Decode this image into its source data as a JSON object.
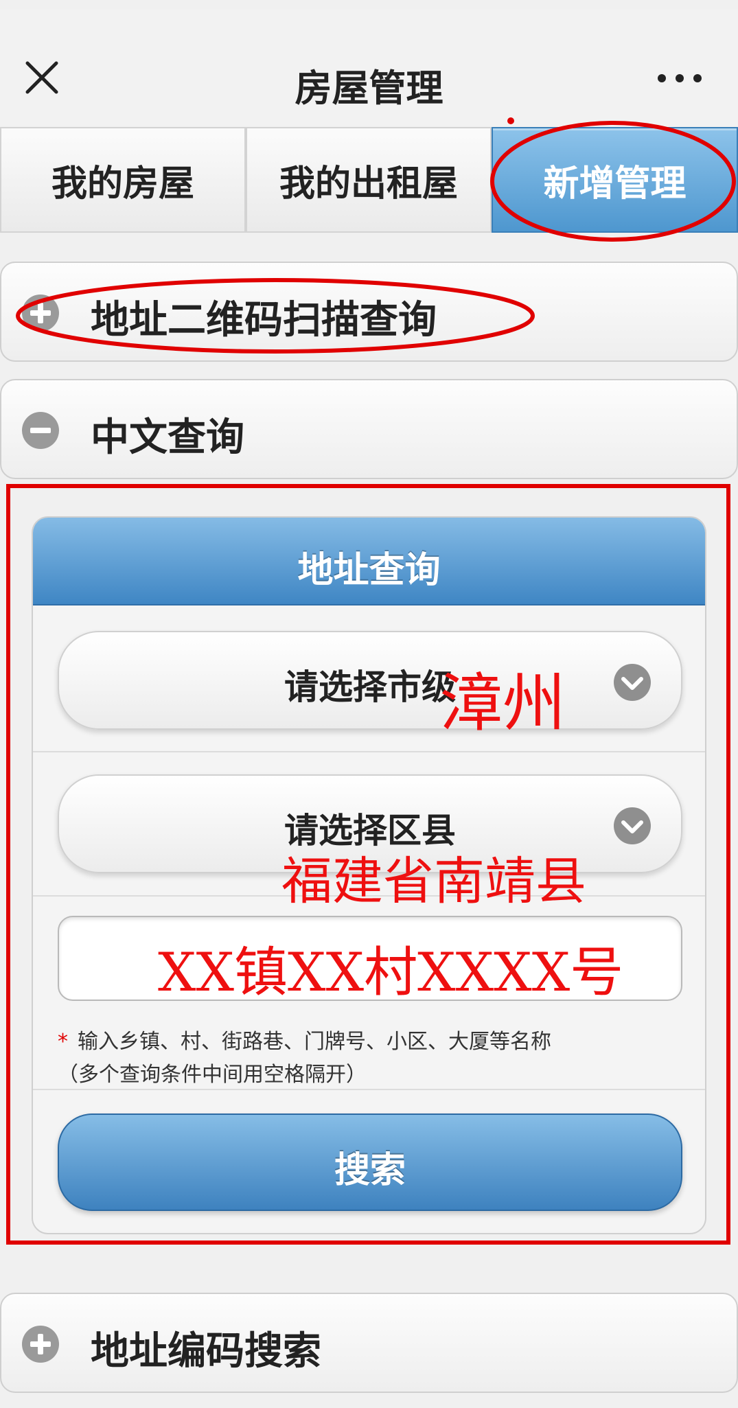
{
  "header": {
    "title": "房屋管理",
    "close_icon": "close-icon",
    "more_icon": "more-icon"
  },
  "tabs": [
    {
      "label": "我的房屋",
      "active": false
    },
    {
      "label": "我的出租屋",
      "active": false
    },
    {
      "label": "新增管理",
      "active": true
    }
  ],
  "sections": {
    "qr_query": {
      "label": "地址二维码扫描查询",
      "icon": "plus-circle-icon"
    },
    "chinese_query": {
      "label": "中文查询",
      "icon": "minus-circle-icon"
    },
    "code_search": {
      "label": "地址编码搜索",
      "icon": "plus-circle-icon"
    }
  },
  "address_form": {
    "title": "地址查询",
    "city_select": {
      "label": "请选择市级",
      "handwritten_value": "漳州"
    },
    "county_select": {
      "label": "请选择区县",
      "handwritten_value": "福建省南靖县"
    },
    "address_input": {
      "handwritten_value": "XX镇XX村XXXX号"
    },
    "hint_star": "*",
    "hint_line1": "输入乡镇、村、街路巷、门牌号、小区、大厦等名称",
    "hint_line2": "（多个查询条件中间用空格隔开）",
    "search_button": "搜索"
  },
  "colors": {
    "accent_blue": "#4e97cf",
    "annotation_red": "#e00000"
  }
}
